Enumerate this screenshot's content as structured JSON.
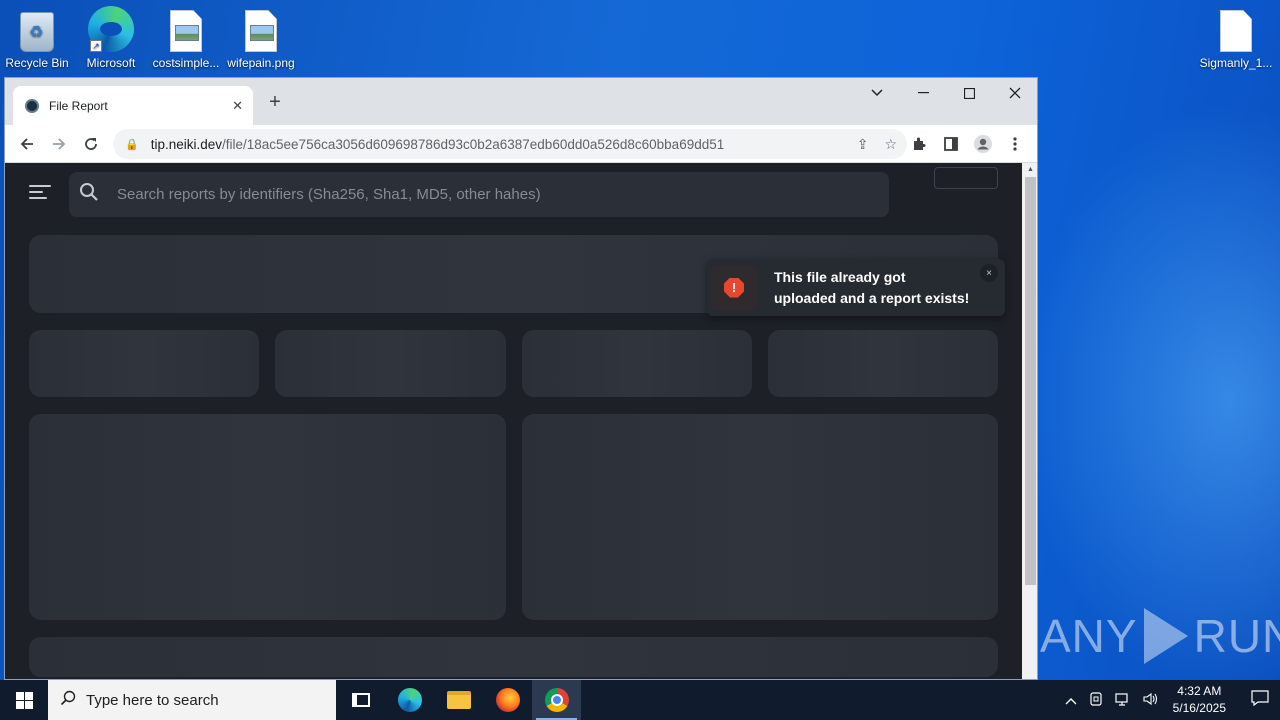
{
  "desktop": {
    "icons": [
      {
        "label": "Recycle Bin",
        "icon": "recycle-bin-icon"
      },
      {
        "label": "Microsoft",
        "icon": "edge-shortcut-icon"
      },
      {
        "label": "costsimple...",
        "icon": "image-file-icon"
      },
      {
        "label": "wifepain.png",
        "icon": "image-file-icon"
      },
      {
        "label": "Sigmanly_1...",
        "icon": "file-icon"
      }
    ]
  },
  "browser": {
    "tab": {
      "title": "File Report",
      "close": "✕"
    },
    "new_tab": "+",
    "url_host": "tip.neiki.dev",
    "url_path": "/file/18ac5ee756ca3056d609698786d93c0b2a6387edb60dd0a526d8c60bba69dd51"
  },
  "page": {
    "search_placeholder": "Search reports by identifiers (Sha256, Sha1, MD5, other hahes)",
    "toast": {
      "message": "This file already got uploaded and a report exists!",
      "icon": "!",
      "close": "×",
      "color": "#e8472f"
    }
  },
  "watermark": {
    "left": "ANY",
    "right": "RUN"
  },
  "taskbar": {
    "search_placeholder": "Type here to search",
    "time": "4:32 AM",
    "date": "5/16/2025"
  }
}
